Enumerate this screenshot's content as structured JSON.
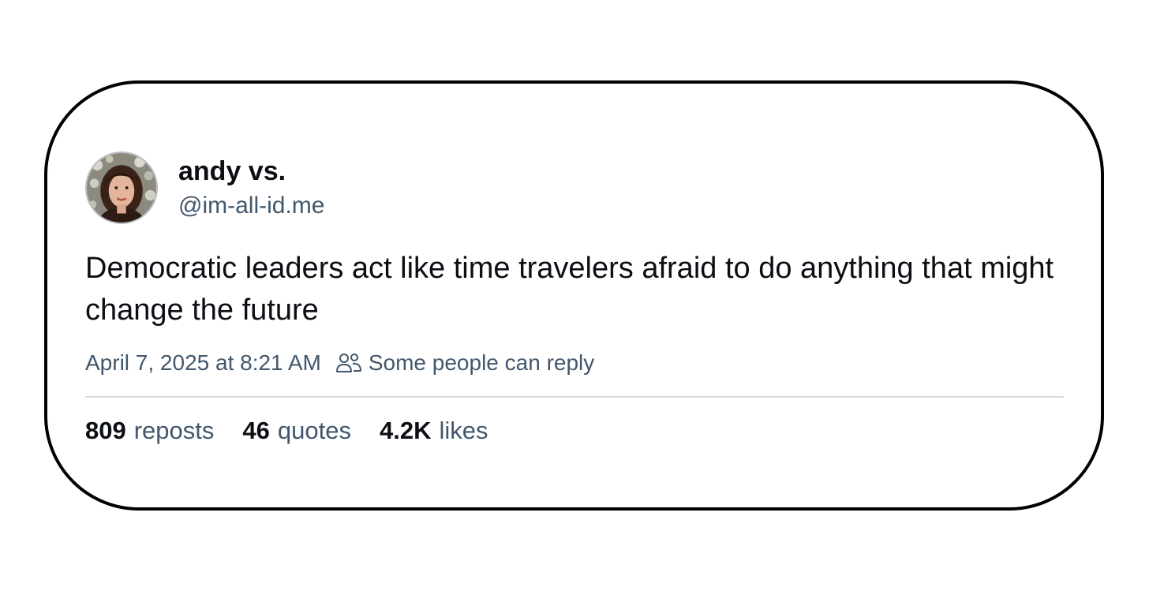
{
  "author": {
    "display_name": "andy vs.",
    "handle": "@im-all-id.me",
    "avatar_icon": "user-avatar"
  },
  "post": {
    "text": "Democratic leaders act like time travelers afraid to do anything that might change the future",
    "timestamp": "April 7, 2025 at 8:21 AM",
    "reply_setting": "Some people can reply",
    "reply_icon": "people-icon"
  },
  "stats": {
    "reposts_count": "809",
    "reposts_label": "reposts",
    "quotes_count": "46",
    "quotes_label": "quotes",
    "likes_count": "4.2K",
    "likes_label": "likes"
  },
  "colors": {
    "text_primary": "#0b0f14",
    "text_secondary": "#42576c",
    "divider": "#d4dbe2",
    "card_border": "#000000"
  }
}
